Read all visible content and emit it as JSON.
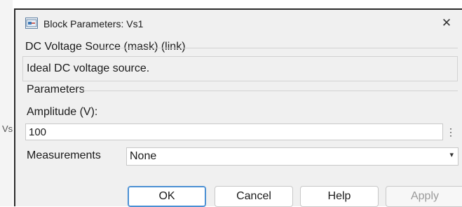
{
  "background": {
    "edge_label": "Vs"
  },
  "dialog": {
    "title": "Block Parameters: Vs1",
    "close_glyph": "✕",
    "app_icon": "simulink-block-icon",
    "mask_title": "DC Voltage Source (mask) (link)",
    "description": "Ideal DC voltage source.",
    "parameters_title": "Parameters",
    "amplitude": {
      "label": "Amplitude (V):",
      "value": "100",
      "menu_glyph": "⋮"
    },
    "measurements": {
      "label": "Measurements",
      "selected": "None",
      "arrow_glyph": "▾"
    },
    "buttons": {
      "ok": "OK",
      "cancel": "Cancel",
      "help": "Help",
      "apply": "Apply"
    },
    "colors": {
      "accent": "#4a8fd3",
      "dialog_bg": "#f0f0f0",
      "disabled_text": "#9a9a9a"
    }
  }
}
